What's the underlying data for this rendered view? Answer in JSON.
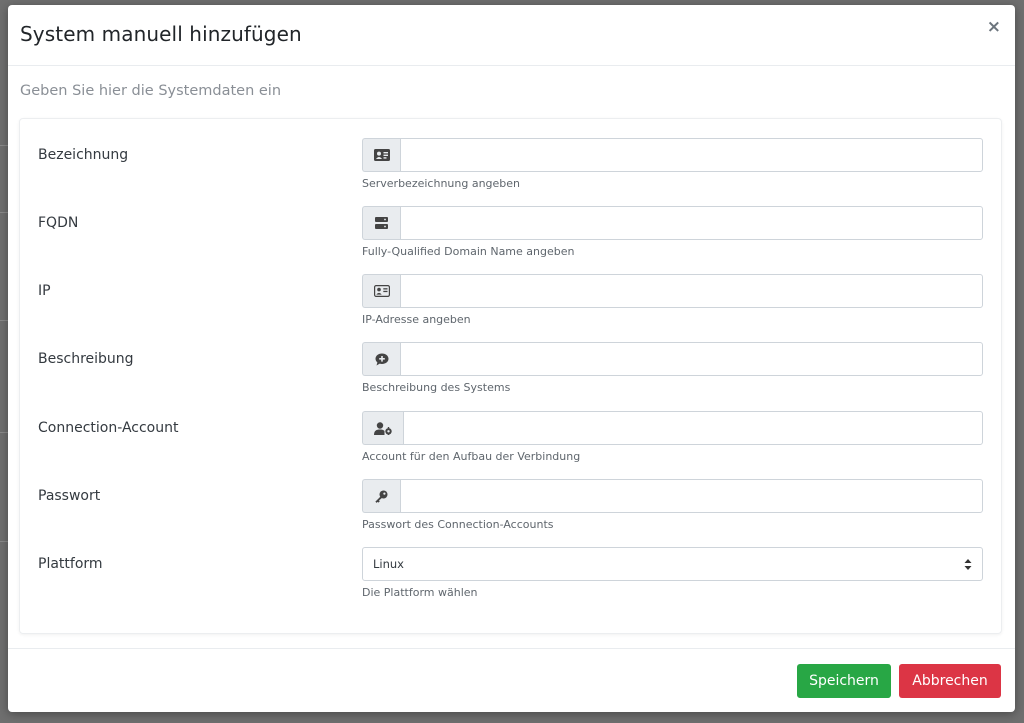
{
  "modal": {
    "title": "System manuell hinzufügen",
    "close_label": "×",
    "subtitle": "Geben Sie hier die Systemdaten ein"
  },
  "fields": [
    {
      "label": "Bezeichnung",
      "icon": "id-card-icon",
      "value": "",
      "help": "Serverbezeichnung angeben"
    },
    {
      "label": "FQDN",
      "icon": "server-icon",
      "value": "",
      "help": "Fully-Qualified Domain Name angeben"
    },
    {
      "label": "IP",
      "icon": "id-card-icon",
      "value": "",
      "help": "IP-Adresse angeben"
    },
    {
      "label": "Beschreibung",
      "icon": "comment-plus-icon",
      "value": "",
      "help": "Beschreibung des Systems"
    },
    {
      "label": "Connection-Account",
      "icon": "user-cog-icon",
      "value": "",
      "help": "Account für den Aufbau der Verbindung"
    },
    {
      "label": "Passwort",
      "icon": "key-icon",
      "value": "",
      "help": "Passwort des Connection-Accounts"
    },
    {
      "label": "Plattform",
      "selected": "Linux",
      "help": "Die Plattform wählen"
    }
  ],
  "footer": {
    "save_label": "Speichern",
    "cancel_label": "Abbrechen"
  },
  "colors": {
    "save": "#28a745",
    "cancel": "#dc3545",
    "backdrop": "#6f6f6f"
  }
}
